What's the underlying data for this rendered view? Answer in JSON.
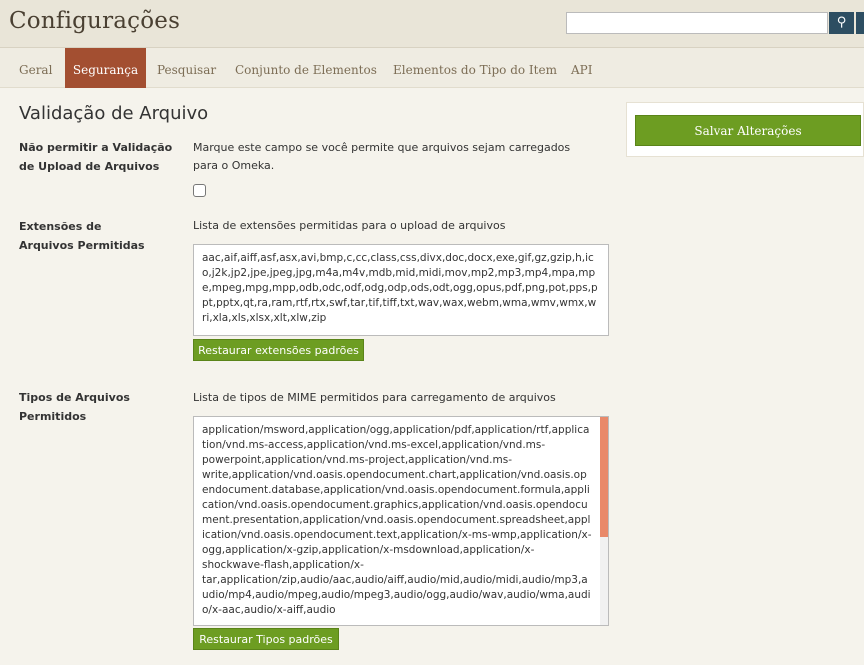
{
  "header": {
    "title": "Configurações",
    "search_placeholder": "",
    "search_icon": "search-icon"
  },
  "tabs": [
    {
      "label": "Geral",
      "active": false
    },
    {
      "label": "Segurança",
      "active": true
    },
    {
      "label": "Pesquisar",
      "active": false
    },
    {
      "label": "Conjunto de Elementos",
      "active": false
    },
    {
      "label": "Elementos do Tipo do Item",
      "active": false
    },
    {
      "label": "API",
      "active": false
    }
  ],
  "section": {
    "title": "Validação de Arquivo"
  },
  "fields": {
    "disable_validation": {
      "label": "Não permitir a Validação de Upload de Arquivos",
      "explanation": "Marque este campo se você permite que arquivos sejam carregados para o Omeka.",
      "checked": false
    },
    "extensions": {
      "label": "Extensões de Arquivos Permitidas",
      "explanation": "Lista de extensões permitidas para o upload de arquivos",
      "value": "aac,aif,aiff,asf,asx,avi,bmp,c,cc,class,css,divx,doc,docx,exe,gif,gz,gzip,h,ico,j2k,jp2,jpe,jpeg,jpg,m4a,m4v,mdb,mid,midi,mov,mp2,mp3,mp4,mpa,mpe,mpeg,mpg,mpp,odb,odc,odf,odg,odp,ods,odt,ogg,opus,pdf,png,pot,pps,ppt,pptx,qt,ra,ram,rtf,rtx,swf,tar,tif,tiff,txt,wav,wax,webm,wma,wmv,wmx,wri,xla,xls,xlsx,xlt,xlw,zip",
      "restore_label": "Restaurar extensões padrões"
    },
    "mime_types": {
      "label": "Tipos de Arquivos Permitidos",
      "explanation": "Lista de tipos de MIME permitidos para carregamento de arquivos",
      "value": "application/msword,application/ogg,application/pdf,application/rtf,application/vnd.ms-access,application/vnd.ms-excel,application/vnd.ms-powerpoint,application/vnd.ms-project,application/vnd.ms-write,application/vnd.oasis.opendocument.chart,application/vnd.oasis.opendocument.database,application/vnd.oasis.opendocument.formula,application/vnd.oasis.opendocument.graphics,application/vnd.oasis.opendocument.presentation,application/vnd.oasis.opendocument.spreadsheet,application/vnd.oasis.opendocument.text,application/x-ms-wmp,application/x-ogg,application/x-gzip,application/x-msdownload,application/x-shockwave-flash,application/x-tar,application/zip,audio/aac,audio/aiff,audio/mid,audio/midi,audio/mp3,audio/mp4,audio/mpeg,audio/mpeg3,audio/ogg,audio/wav,audio/wma,audio/x-aac,audio/x-aiff,audio",
      "restore_label": "Restaurar Tipos padrões"
    }
  },
  "sidebar": {
    "save_label": "Salvar Alterações"
  },
  "colors": {
    "active_tab": "#a34f31",
    "button_green": "#6d9d22",
    "search_button": "#2d4e62"
  }
}
